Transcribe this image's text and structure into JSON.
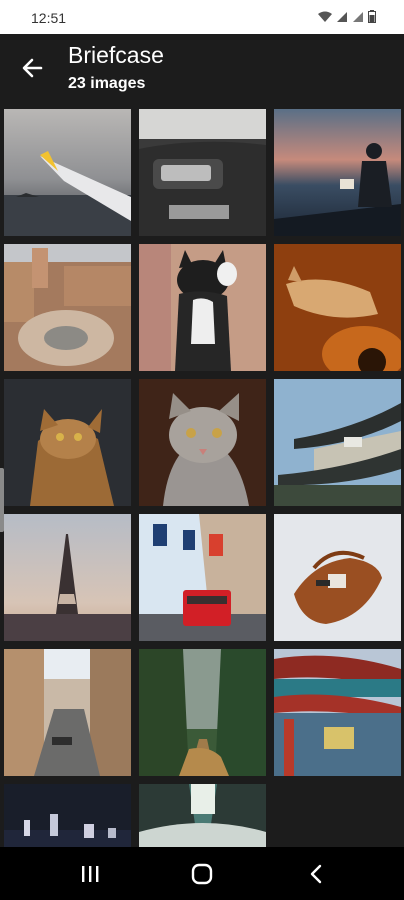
{
  "status_bar": {
    "time": "12:51"
  },
  "app_bar": {
    "title": "Briefcase",
    "subtitle": "23 images"
  },
  "gallery": {
    "images": [
      {
        "subject": "airplane-wing"
      },
      {
        "subject": "car-dashboard"
      },
      {
        "subject": "person-on-cliff"
      },
      {
        "subject": "city-plaza-fountain"
      },
      {
        "subject": "kitten-playing"
      },
      {
        "subject": "cat-on-guitar"
      },
      {
        "subject": "cat-looking-up"
      },
      {
        "subject": "tabby-cat"
      },
      {
        "subject": "asian-temple-roof"
      },
      {
        "subject": "eiffel-tower"
      },
      {
        "subject": "london-street-bus"
      },
      {
        "subject": "leather-bag"
      },
      {
        "subject": "venice-canal"
      },
      {
        "subject": "forest-road"
      },
      {
        "subject": "chinatown-gate"
      },
      {
        "subject": "city-skyline-night"
      },
      {
        "subject": "canyon-water"
      }
    ]
  }
}
